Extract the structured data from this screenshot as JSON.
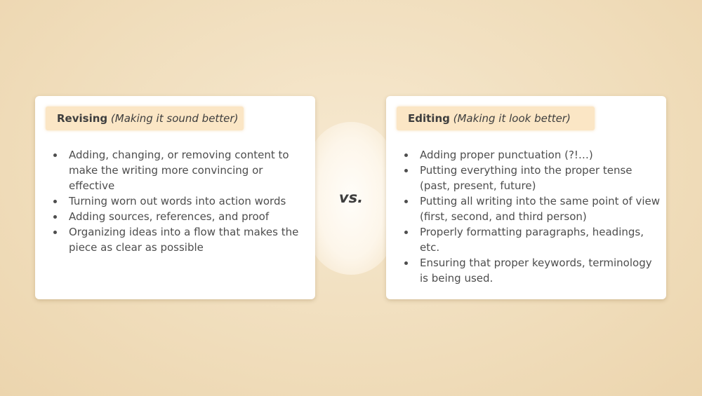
{
  "left_card": {
    "title": "Revising",
    "subtitle": "(Making it sound better)",
    "items": [
      "Adding, changing, or removing content to make the writing more convincing or effective",
      "Turning worn out words into action words",
      "Adding sources, references, and proof",
      "Organizing ideas into a flow that makes the piece as clear as possible"
    ]
  },
  "vs_label": "vs.",
  "right_card": {
    "title": "Editing",
    "subtitle": "(Making it look better)",
    "items": [
      "Adding proper punctuation (?!…)",
      "Putting everything into the proper tense (past, present, future)",
      "Putting all writing into the same point of view (first, second, and third person)",
      "Properly formatting paragraphs, headings, etc.",
      "Ensuring that proper keywords, terminology is being used."
    ]
  },
  "colors": {
    "background": "#f2dfbd",
    "header_highlight": "#fbe6c5",
    "card": "#ffffff",
    "text": "#4d4d4d"
  }
}
